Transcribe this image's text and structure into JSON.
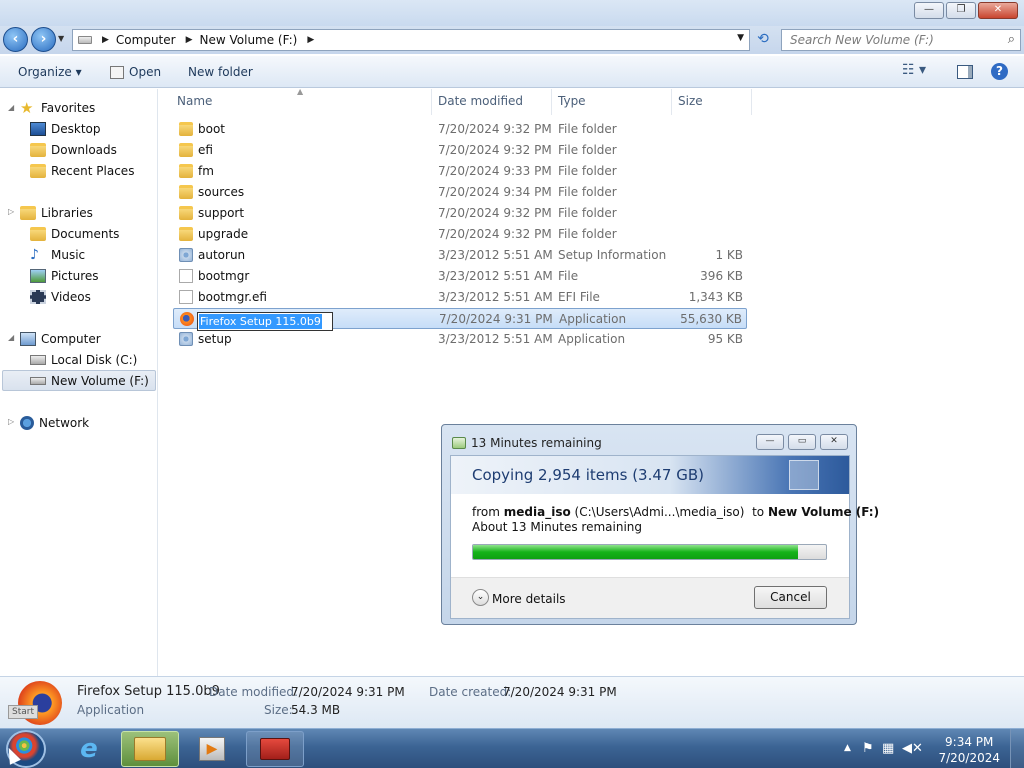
{
  "window": {
    "minimize": "—",
    "restore": "❐",
    "close": "✕"
  },
  "address": {
    "crumbs": [
      "Computer",
      "New Volume (F:)"
    ],
    "search_placeholder": "Search New Volume (F:)"
  },
  "toolbar": {
    "organize": "Organize ▾",
    "open": "Open",
    "new_folder": "New folder"
  },
  "nav": {
    "favorites": "Favorites",
    "desktop": "Desktop",
    "downloads": "Downloads",
    "recent_places": "Recent Places",
    "libraries": "Libraries",
    "documents": "Documents",
    "music": "Music",
    "pictures": "Pictures",
    "videos": "Videos",
    "computer": "Computer",
    "local_disk": "Local Disk (C:)",
    "new_volume": "New Volume (F:)",
    "network": "Network"
  },
  "columns": {
    "name": "Name",
    "date": "Date modified",
    "type": "Type",
    "size": "Size"
  },
  "files": [
    {
      "name": "boot",
      "date": "7/20/2024 9:32 PM",
      "type": "File folder",
      "size": "",
      "icon": "folder"
    },
    {
      "name": "efi",
      "date": "7/20/2024 9:32 PM",
      "type": "File folder",
      "size": "",
      "icon": "folder"
    },
    {
      "name": "fm",
      "date": "7/20/2024 9:33 PM",
      "type": "File folder",
      "size": "",
      "icon": "folder"
    },
    {
      "name": "sources",
      "date": "7/20/2024 9:34 PM",
      "type": "File folder",
      "size": "",
      "icon": "folder"
    },
    {
      "name": "support",
      "date": "7/20/2024 9:32 PM",
      "type": "File folder",
      "size": "",
      "icon": "folder"
    },
    {
      "name": "upgrade",
      "date": "7/20/2024 9:32 PM",
      "type": "File folder",
      "size": "",
      "icon": "folder"
    },
    {
      "name": "autorun",
      "date": "3/23/2012 5:51 AM",
      "type": "Setup Information",
      "size": "1 KB",
      "icon": "gear"
    },
    {
      "name": "bootmgr",
      "date": "3/23/2012 5:51 AM",
      "type": "File",
      "size": "396 KB",
      "icon": "doc"
    },
    {
      "name": "bootmgr.efi",
      "date": "3/23/2012 5:51 AM",
      "type": "EFI File",
      "size": "1,343 KB",
      "icon": "doc"
    },
    {
      "name": "Firefox Setup 115.0b9",
      "date": "7/20/2024 9:31 PM",
      "type": "Application",
      "size": "55,630 KB",
      "icon": "firefox"
    },
    {
      "name": "setup",
      "date": "3/23/2012 5:51 AM",
      "type": "Application",
      "size": "95 KB",
      "icon": "gear"
    }
  ],
  "details": {
    "name": "Firefox Setup 115.0b9",
    "kind": "Application",
    "modified_label": "Date modified:",
    "modified_value": "7/20/2024 9:31 PM",
    "created_label": "Date created:",
    "created_value": "7/20/2024 9:31 PM",
    "size_label": "Size:",
    "size_value": "54.3 MB",
    "start_tip": "Start"
  },
  "dialog": {
    "title": "13 Minutes remaining",
    "heading": "Copying 2,954 items (3.47 GB)",
    "from_label": "from",
    "source": "media_iso",
    "source_path": "(C:\\Users\\Admi...\\media_iso)",
    "to_label": "to",
    "dest": "New Volume (F:)",
    "remaining": "About 13 Minutes remaining",
    "progress_fraction": 0.92,
    "more_details": "More details",
    "cancel": "Cancel"
  },
  "taskbar": {
    "time": "9:34 PM",
    "date": "7/20/2024"
  }
}
